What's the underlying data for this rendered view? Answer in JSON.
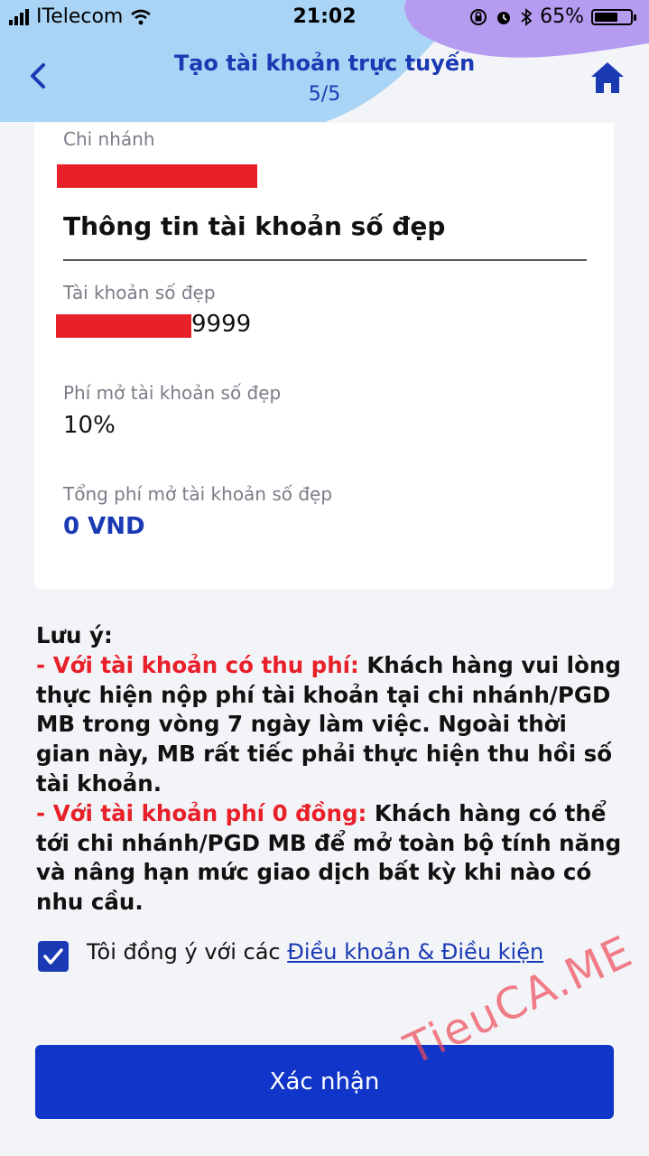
{
  "status_bar": {
    "carrier": "ITelecom",
    "time": "21:02",
    "battery_percent": "65%",
    "battery_level": 0.65
  },
  "header": {
    "title": "Tạo tài khoản trực tuyến",
    "step": "5/5",
    "back_icon": "chevron-left-icon",
    "home_icon": "home-icon"
  },
  "card": {
    "branch_label": "Chi nhánh",
    "section_title": "Thông tin tài khoản số đẹp",
    "account_label": "Tài khoản số đẹp",
    "account_suffix": "9999",
    "fee_label": "Phí mở tài khoản số đẹp",
    "fee_value": "10%",
    "total_label": "Tổng phí mở tài khoản số đẹp",
    "total_value": "0 VND"
  },
  "note": {
    "heading": "Lưu ý:",
    "item1_highlight": "- Với tài khoản có thu phí:",
    "item1_text": " Khách hàng vui lòng thực hiện nộp phí tài khoản tại chi nhánh/PGD MB trong vòng 7 ngày làm việc. Ngoài thời gian này, MB rất tiếc phải thực hiện thu hồi số tài khoản.",
    "item2_highlight": "- Với tài khoản phí 0 đồng:",
    "item2_text": " Khách hàng có thể tới chi nhánh/PGD MB để mở toàn bộ tính năng và nâng hạn mức giao dịch bất kỳ khi nào có nhu cầu."
  },
  "agreement": {
    "text": "Tôi đồng ý với các ",
    "link": "Điều khoản & Điều kiện",
    "checked": true
  },
  "confirm_button": "Xác nhận",
  "watermark": "TieuCA.ME",
  "colors": {
    "primary": "#1a3ab4",
    "button": "#1035c8",
    "highlight_red": "#e8202a",
    "header_blue": "#a9d4f5",
    "header_purple": "#b59cf0",
    "background": "#f3f4f8"
  }
}
